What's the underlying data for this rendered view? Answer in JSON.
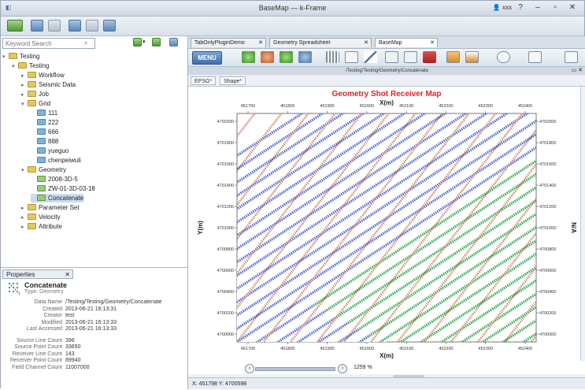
{
  "window": {
    "title": "BaseMap — k-Frame",
    "user": "xxx"
  },
  "search": {
    "placeholder": "Keyword Search"
  },
  "tree": [
    {
      "label": "Testing",
      "depth": 0,
      "icon": "folder",
      "expanded": true
    },
    {
      "label": "Testing",
      "depth": 1,
      "icon": "folder",
      "expanded": true
    },
    {
      "label": "Workflow",
      "depth": 2,
      "icon": "folder"
    },
    {
      "label": "Seismic Data",
      "depth": 2,
      "icon": "folder"
    },
    {
      "label": "Job",
      "depth": 2,
      "icon": "folder"
    },
    {
      "label": "Grid",
      "depth": 2,
      "icon": "folder",
      "expanded": true
    },
    {
      "label": "111",
      "depth": 3,
      "icon": "doc"
    },
    {
      "label": "222",
      "depth": 3,
      "icon": "doc"
    },
    {
      "label": "666",
      "depth": 3,
      "icon": "doc"
    },
    {
      "label": "888",
      "depth": 3,
      "icon": "doc"
    },
    {
      "label": "yueguo",
      "depth": 3,
      "icon": "doc"
    },
    {
      "label": "chenpeiwuli",
      "depth": 3,
      "icon": "doc"
    },
    {
      "label": "Geometry",
      "depth": 2,
      "icon": "folder",
      "expanded": true
    },
    {
      "label": "2008-3D-5",
      "depth": 3,
      "icon": "geo"
    },
    {
      "label": "ZW-01-3D-03-18",
      "depth": 3,
      "icon": "geo"
    },
    {
      "label": "Concatenate",
      "depth": 3,
      "icon": "geo",
      "selected": true
    },
    {
      "label": "Parameter Set",
      "depth": 2,
      "icon": "folder"
    },
    {
      "label": "Velocity",
      "depth": 2,
      "icon": "folder"
    },
    {
      "label": "Attribute",
      "depth": 2,
      "icon": "folder"
    }
  ],
  "properties": {
    "tab": "Properties",
    "name": "Concatenate",
    "type": "Type: Geometry",
    "rows": [
      {
        "k": "Data Name",
        "v": "/Testing/Testing/Geometry/Concatenate"
      },
      {
        "k": "Created",
        "v": "2013-06-21 16:13:31"
      },
      {
        "k": "Creator",
        "v": "test"
      },
      {
        "k": "Modified",
        "v": "2013-06-21 16:13:33"
      },
      {
        "k": "Last Accessed",
        "v": "2013-06-21 16:13:33"
      },
      {
        "k": "Source Line Count",
        "v": "396"
      },
      {
        "k": "Source Point Count",
        "v": "33650"
      },
      {
        "k": "Receiver Line Count",
        "v": "143"
      },
      {
        "k": "Receiver Point Count",
        "v": "89940"
      },
      {
        "k": "Field Channel Count",
        "v": "11007000"
      }
    ]
  },
  "doctabs": [
    {
      "label": "TabOnlyPluginDemo",
      "active": false
    },
    {
      "label": "Geometry Spreadsheet",
      "active": false
    },
    {
      "label": "BaseMap",
      "active": true
    }
  ],
  "toolbar": {
    "menu_label": "MENU"
  },
  "path": "/Testing/Testing/Geometry/Concatenate",
  "subtabs": [
    "EPSG*",
    "Shape*"
  ],
  "zoom_label": "1259 %",
  "status": "X: 451798 Y: 4700598",
  "chart_data": {
    "type": "scatter",
    "title": "Geometry Shot Receiver Map",
    "xlabel": "X(m)",
    "ylabel": "Y(m)",
    "ylabel_right": "N/A",
    "x_ticks": [
      "451700",
      "451800",
      "451900",
      "452000",
      "452100",
      "452200",
      "452300",
      "452400"
    ],
    "y_ticks": [
      "4702000",
      "4701800",
      "4701600",
      "4701400",
      "4701200",
      "4701000",
      "4700800",
      "4700600",
      "4700400",
      "4700200",
      "4700000"
    ],
    "xlim": [
      451650,
      452450
    ],
    "ylim": [
      4699900,
      4702100
    ],
    "line_angle_deg": 33,
    "series": [
      {
        "name": "",
        "color": "#2aa84a",
        "role": "receiver-lines"
      },
      {
        "name": "",
        "color": "#4a63d8",
        "role": "receiver-lines-2"
      },
      {
        "name": "",
        "color": "#c8724b",
        "role": "source-lines"
      }
    ]
  }
}
